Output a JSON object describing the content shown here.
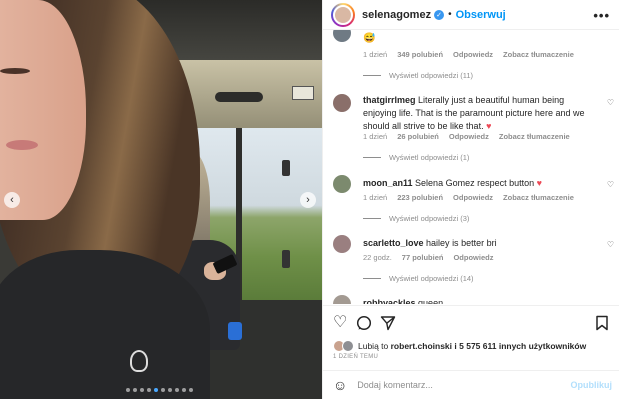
{
  "post": {
    "username": "selenagomez",
    "follow_label": "Obserwuj",
    "separator": "•",
    "more": "•••"
  },
  "media": {
    "prev_arrow": "‹",
    "next_arrow": "›",
    "slide_count": 10,
    "active_slide": 4
  },
  "comments": [
    {
      "username": "",
      "text": "",
      "time": "1 dzień",
      "likes": "349 polubień",
      "reply": "Odpowiedz",
      "translate": "Zobacz tłumaczenie",
      "view_replies": "Wyświetl odpowiedzi (11)"
    },
    {
      "username": "thatgirrlmeg",
      "text": "Literally just a beautiful human being enjoying life. That is the paramount picture here and we should all strive to be like that.",
      "emoji": "♥",
      "time": "1 dzień",
      "likes": "26 polubień",
      "reply": "Odpowiedz",
      "translate": "Zobacz tłumaczenie",
      "view_replies": "Wyświetl odpowiedzi (1)"
    },
    {
      "username": "moon_an11",
      "text": "Selena Gomez respect button",
      "emoji": "♥",
      "time": "1 dzień",
      "likes": "223 polubień",
      "reply": "Odpowiedz",
      "translate": "Zobacz tłumaczenie",
      "view_replies": "Wyświetl odpowiedzi (3)"
    },
    {
      "username": "scarletto_love",
      "text": "hailey is better bri",
      "time": "22 godz.",
      "likes": "77 polubień",
      "reply": "Odpowiedz",
      "view_replies": "Wyświetl odpowiedzi (14)"
    },
    {
      "username": "robbyackles",
      "text": "queen"
    }
  ],
  "actions": {
    "like_icon": "heart-outline-icon",
    "comment_icon": "comment-bubble-icon",
    "share_icon": "paper-plane-icon",
    "save_icon": "bookmark-icon"
  },
  "likes": {
    "prefix": "Lubią to",
    "user": "robert.choinski",
    "suffix": "i 5 575 611 innych użytkowników"
  },
  "timestamp": "1 DZIEŃ TEMU",
  "add_comment": {
    "placeholder": "Dodaj komentarz...",
    "publish_label": "Opublikuj"
  },
  "colors": {
    "accent": "#0095f6",
    "verified": "#3897f0",
    "heart_red": "#ed4956",
    "muted_text": "#8e8e8e"
  }
}
